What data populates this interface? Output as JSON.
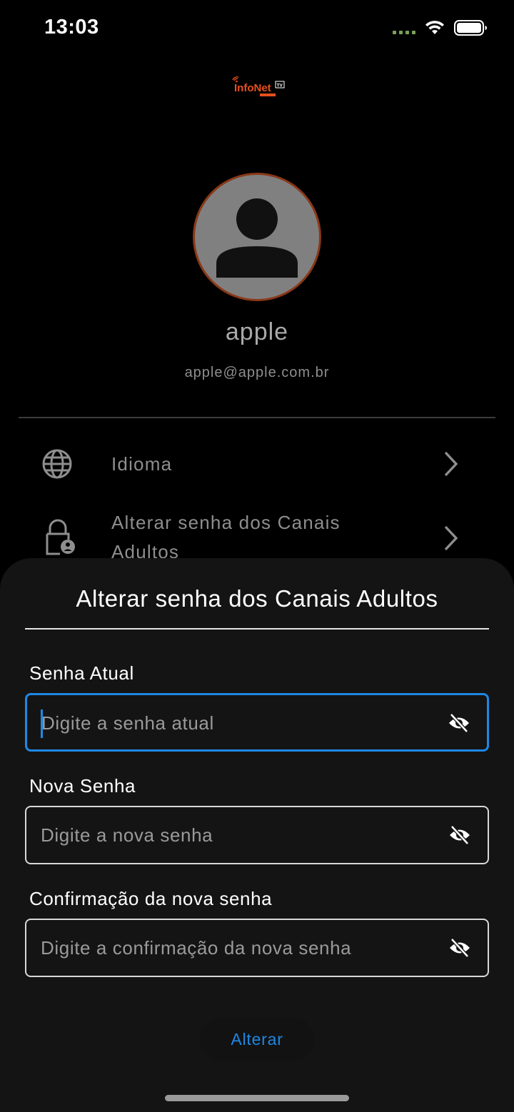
{
  "status_bar": {
    "time": "13:03",
    "signal_icon": "cellular-signal-dots",
    "wifi_icon": "wifi-icon",
    "battery_icon": "battery-full-icon"
  },
  "logo": {
    "text": "InfoNet",
    "badge": "TV",
    "colors": {
      "primary": "#e8501e",
      "badge": "#ffffff"
    }
  },
  "profile": {
    "avatar_icon": "person-icon",
    "name": "apple",
    "email": "apple@apple.com.br"
  },
  "menu": {
    "items": [
      {
        "icon": "globe-icon",
        "label": "Idioma",
        "chevron": "chevron-right-icon"
      },
      {
        "icon": "lock-person-icon",
        "label_line1": "Alterar senha dos Canais",
        "label_line2": "Adultos",
        "chevron": "chevron-right-icon"
      }
    ]
  },
  "sheet": {
    "title": "Alterar senha dos Canais Adultos",
    "fields": [
      {
        "label": "Senha Atual",
        "placeholder": "Digite a senha atual",
        "focused": true,
        "toggle_icon": "eye-off-icon"
      },
      {
        "label": "Nova Senha",
        "placeholder": "Digite a nova senha",
        "focused": false,
        "toggle_icon": "eye-off-icon"
      },
      {
        "label": "Confirmação da nova senha",
        "placeholder": "Digite a confirmação da nova senha",
        "focused": false,
        "toggle_icon": "eye-off-icon"
      }
    ],
    "submit_label": "Alterar"
  },
  "colors": {
    "accent": "#1e88e5",
    "background": "#000000",
    "sheet_background": "#141414",
    "avatar_border": "#8a3818"
  }
}
